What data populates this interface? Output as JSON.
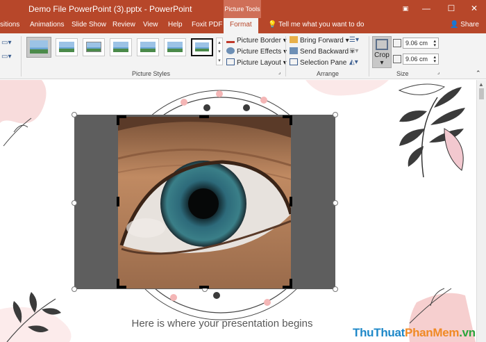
{
  "titlebar": {
    "title": "Demo File PowerPoint (3).pptx  -  PowerPoint",
    "context_tool": "Picture Tools",
    "accent": "#b7472a"
  },
  "tabs": {
    "items": [
      "sitions",
      "Animations",
      "Slide Show",
      "Review",
      "View",
      "Help",
      "Foxit PDF",
      "Format"
    ],
    "active": "Format",
    "tell_me": "Tell me what you want to do",
    "share": "Share"
  },
  "ribbon": {
    "picture_styles": {
      "label": "Picture Styles",
      "picture_border": "Picture Border",
      "picture_effects": "Picture Effects",
      "picture_layout": "Picture Layout"
    },
    "arrange": {
      "label": "Arrange",
      "bring_forward": "Bring Forward",
      "send_backward": "Send Backward",
      "selection_pane": "Selection Pane"
    },
    "size": {
      "label": "Size",
      "crop": "Crop",
      "height": "9.06 cm",
      "width": "9.06 cm"
    }
  },
  "slide": {
    "caption": "Here is where your presentation begins"
  },
  "watermark": {
    "part1": "ThuThuat",
    "part2": "PhanMem",
    "part3": ".vn"
  },
  "icons": {
    "minimize": "minimize-icon",
    "restore": "restore-icon",
    "close": "close-icon",
    "lightbulb": "lightbulb-icon",
    "person": "person-icon"
  }
}
